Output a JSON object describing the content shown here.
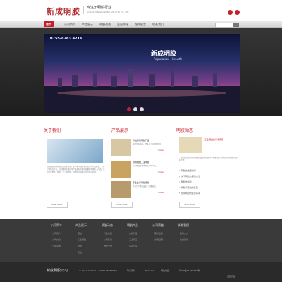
{
  "header": {
    "logo": "新成明胶",
    "slogan_cn": "专注于明胶行业",
    "slogan_en": "GOKASUAN GROWING GELATIN CO.,LTD"
  },
  "nav": {
    "items": [
      "首页",
      "公司简介",
      "产品展示",
      "明胶动态",
      "企业文化",
      "在线留言",
      "联系我们"
    ],
    "active_index": 0
  },
  "banner": {
    "phone": "0755-8263 4716",
    "title": "新成明胶",
    "subtitle": "Reputation · Growth"
  },
  "about": {
    "title": "关于我们",
    "text": "新成明胶科技有限公司位于深圳，是一家专业从事明胶系列产品研发、生产与销售的企业。公司拥有先进的生产设备和完善的质量检测体系，产品广泛应用于食品、医药、化工等领域，深受国内外客户的信赖与好评。",
    "more": "READ MORE"
  },
  "products": {
    "title": "产品展示",
    "items": [
      {
        "title": "骨胶系列明胶产品",
        "desc": "采用优质原料，经多道工序精制而成。",
        "more": "more"
      },
      {
        "title": "食用明胶工业明胶",
        "desc": "工业明胶及食用明胶系列产品。",
        "more": "more"
      },
      {
        "title": "专业生产骨胶皮胶",
        "desc": "专业生产骨胶皮胶，质量稳定。",
        "more": "more"
      }
    ],
    "more": "READ MORE"
  },
  "news": {
    "title": "明胶动态",
    "featured": "工业明胶的基本原理",
    "intro": "工业明胶是从动物的骨骼或皮肤中提取的一种蛋白质，具有良好的凝胶性和粘合性。",
    "items": [
      "1  明胶的发展前景",
      "2  关于明胶的使用方法",
      "3  明胶的用途",
      "4  骨胶与皮胶的区别",
      "5  食用明胶的注意事项"
    ],
    "more": "READ MORE"
  },
  "footer": {
    "columns": [
      {
        "title": "公司简介",
        "links": [
          "公司简介",
          "公司文化",
          "公司资质"
        ]
      },
      {
        "title": "产品展示",
        "links": [
          "明胶",
          "工业明胶",
          "骨胶",
          "皮胶"
        ]
      },
      {
        "title": "明胶动态",
        "links": [
          "行业新闻",
          "公司新闻",
          "技术文章"
        ]
      },
      {
        "title": "明胶产品",
        "links": [
          "食用产品",
          "工业产品",
          "医药产品"
        ]
      },
      {
        "title": "公司荣誉",
        "links": [
          "荣誉证书",
          "资质证明"
        ]
      },
      {
        "title": "联系我们",
        "links": [
          "联系方式",
          "在线留言"
        ]
      }
    ]
  },
  "bottom": {
    "brand": "新成明胶公司",
    "copyright": "© 2011-2016 ALL RIGHT RESERVED",
    "links": [
      "联系我们",
      "ENGLISH",
      "网站地图"
    ],
    "icp": "粤ICP备11039787号",
    "back_top": "返回顶部"
  },
  "colors": {
    "accent": "#c8202b",
    "dark": "#2b2b2b"
  }
}
